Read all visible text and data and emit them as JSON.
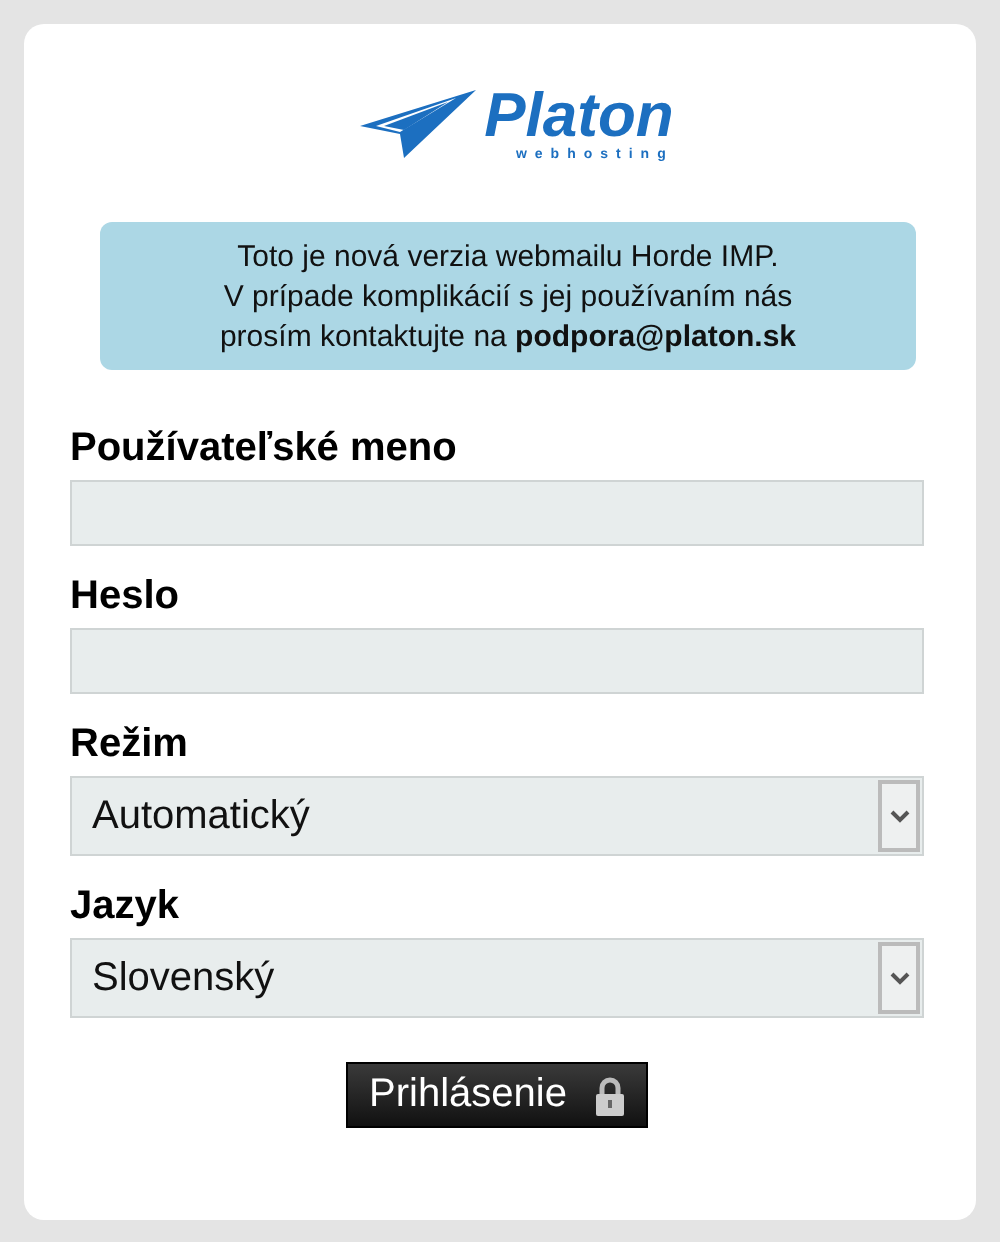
{
  "logo": {
    "name": "Platon",
    "tagline": "webhosting"
  },
  "notice": {
    "lines": [
      "Toto je nová verzia webmailu Horde IMP.",
      "V prípade komplikácií s jej používaním nás",
      "prosím kontaktujte na **podpora@platon.sk**"
    ]
  },
  "fields": [
    {
      "kind": "text",
      "label": "Používateľské meno"
    },
    {
      "kind": "password",
      "label": "Heslo"
    },
    {
      "kind": "select",
      "label": "Režim",
      "value": "Automatický"
    },
    {
      "kind": "select",
      "label": "Jazyk",
      "value": "Slovenský"
    }
  ],
  "login_button": {
    "label": "Prihlásenie"
  }
}
